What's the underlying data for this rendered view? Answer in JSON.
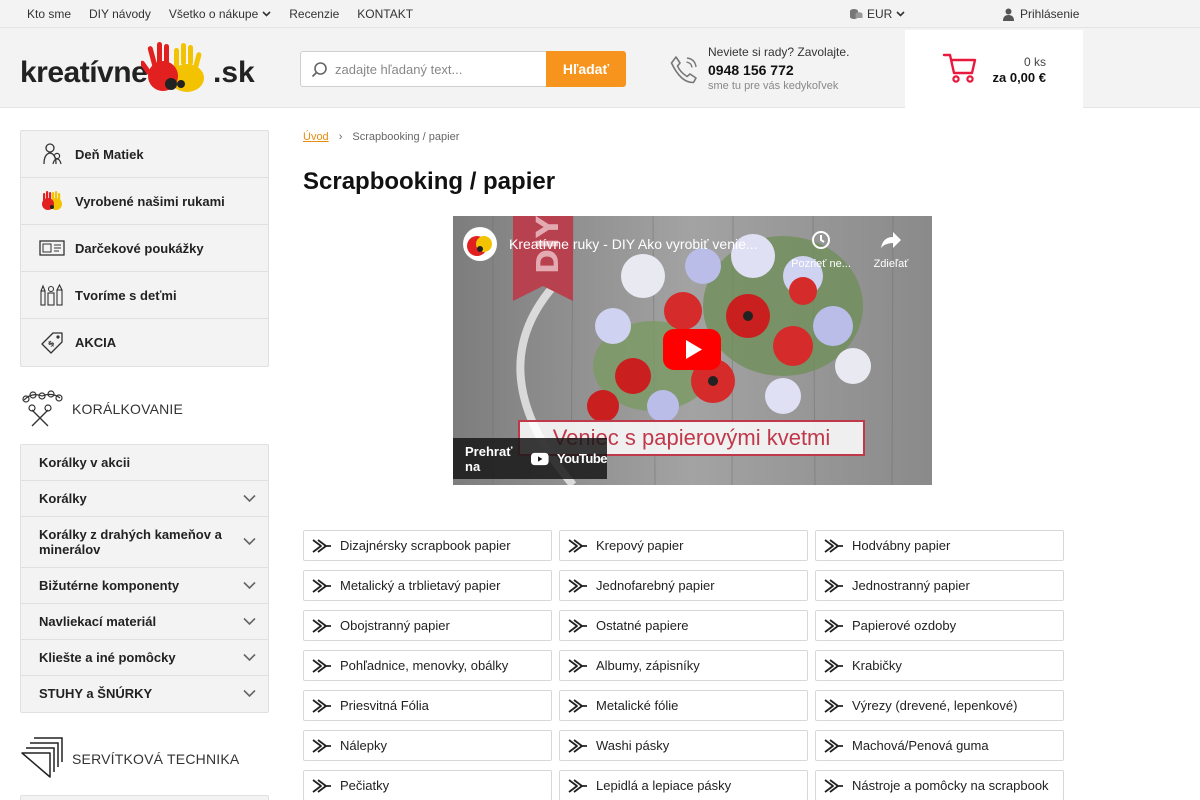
{
  "topbar": {
    "nav": [
      "Kto sme",
      "DIY návody",
      "Všetko o nákupe",
      "Recenzie",
      "KONTAKT"
    ],
    "currency": "EUR",
    "login": "Prihlásenie"
  },
  "logo": {
    "word": "kreatívne",
    "tld": ".sk"
  },
  "search": {
    "placeholder": "zadajte hľadaný text...",
    "value": "",
    "button": "Hľadať"
  },
  "phone": {
    "line1": "Neviete si rady? Zavolajte.",
    "number": "0948 156 772",
    "line2": "sme tu pre vás kedykoľvek"
  },
  "cart": {
    "count": "0 ks",
    "total": "za 0,00 €"
  },
  "promo": [
    {
      "label": "Deň Matiek",
      "icon": "mother-child-icon"
    },
    {
      "label": "Vyrobené našimi rukami",
      "icon": "hands-icon"
    },
    {
      "label": "Darčekové poukážky",
      "icon": "voucher-icon"
    },
    {
      "label": "Tvoríme s deťmi",
      "icon": "kids-crafts-icon"
    },
    {
      "label": "AKCIA",
      "icon": "sale-tag-icon"
    }
  ],
  "sections": [
    {
      "title": "KORÁLKOVANIE",
      "icon": "beads-icon",
      "items": [
        {
          "label": "Korálky v akcii",
          "hasChildren": false
        },
        {
          "label": "Korálky",
          "hasChildren": true
        },
        {
          "label": "Korálky z drahých kameňov a minerálov",
          "hasChildren": true
        },
        {
          "label": "Bižutérne komponenty",
          "hasChildren": true
        },
        {
          "label": "Navliekací materiál",
          "hasChildren": true
        },
        {
          "label": "Kliešte a iné pomôcky",
          "hasChildren": true
        },
        {
          "label": "STUHY a ŠNÚRKY",
          "hasChildren": true
        }
      ]
    },
    {
      "title": "SERVÍTKOVÁ TECHNIKA",
      "icon": "napkins-icon",
      "items": []
    }
  ],
  "breadcrumb": {
    "home": "Úvod",
    "separator": "›",
    "current": "Scrapbooking / papier"
  },
  "page_title": "Scrapbooking / papier",
  "video": {
    "title": "Kreatívne ruky - DIY Ako vyrobiť venie...",
    "watch_later": "Pozrieť ne...",
    "share": "Zdieľať",
    "banner": "Veniec s papierovými kvetmi",
    "badge": "DIY",
    "watch_on": "Prehrať na",
    "platform": "YouTube"
  },
  "subcategories": [
    "Dizajnérsky scrapbook papier",
    "Krepový papier",
    "Hodvábny papier",
    "Metalický a trblietavý papier",
    "Jednofarebný papier",
    "Jednostranný papier",
    "Obojstranný papier",
    "Ostatné papiere",
    "Papierové ozdoby",
    "Pohľadnice, menovky, obálky",
    "Albumy, zápisníky",
    "Krabičky",
    "Priesvitná Fólia",
    "Metalické fólie",
    "Výrezy (drevené, lepenkové)",
    "Nálepky",
    "Washi pásky",
    "Machová/Penová guma",
    "Pečiatky",
    "Lepidlá a lepiace pásky",
    "Nástroje a pomôcky na scrapbook"
  ],
  "colors": {
    "accent": "#f7941d",
    "cart": "#e8193c",
    "youtube": "#ff0000",
    "crumb": "#e88c0e"
  }
}
